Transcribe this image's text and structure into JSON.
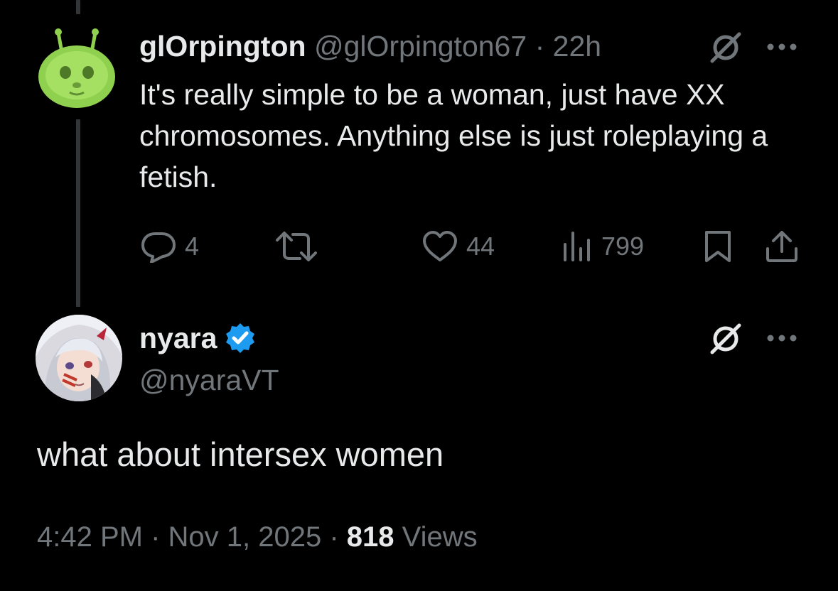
{
  "parent_tweet": {
    "display_name": "glOrpington",
    "handle": "@glOrpington67",
    "separator": "·",
    "time_ago": "22h",
    "text": "It's really simple to be a woman, just have XX chromosomes. Anything else is just roleplaying a fetish.",
    "stats": {
      "replies": "4",
      "likes": "44",
      "views": "799"
    },
    "avatar_icon": "green-alien-cat-avatar"
  },
  "reply_tweet": {
    "display_name": "nyara",
    "handle": "@nyaraVT",
    "text": "what about intersex women",
    "timestamp": "4:42 PM · Nov 1, 2025 · ",
    "view_count": "818",
    "views_label": " Views",
    "avatar_icon": "anime-character-avatar",
    "verified_icon": "verified-badge-icon"
  },
  "colors": {
    "background": "#000000",
    "text_primary": "#e7e9ea",
    "text_muted": "#71767b",
    "thread_line": "#333639",
    "verified_blue": "#1d9bf0"
  }
}
